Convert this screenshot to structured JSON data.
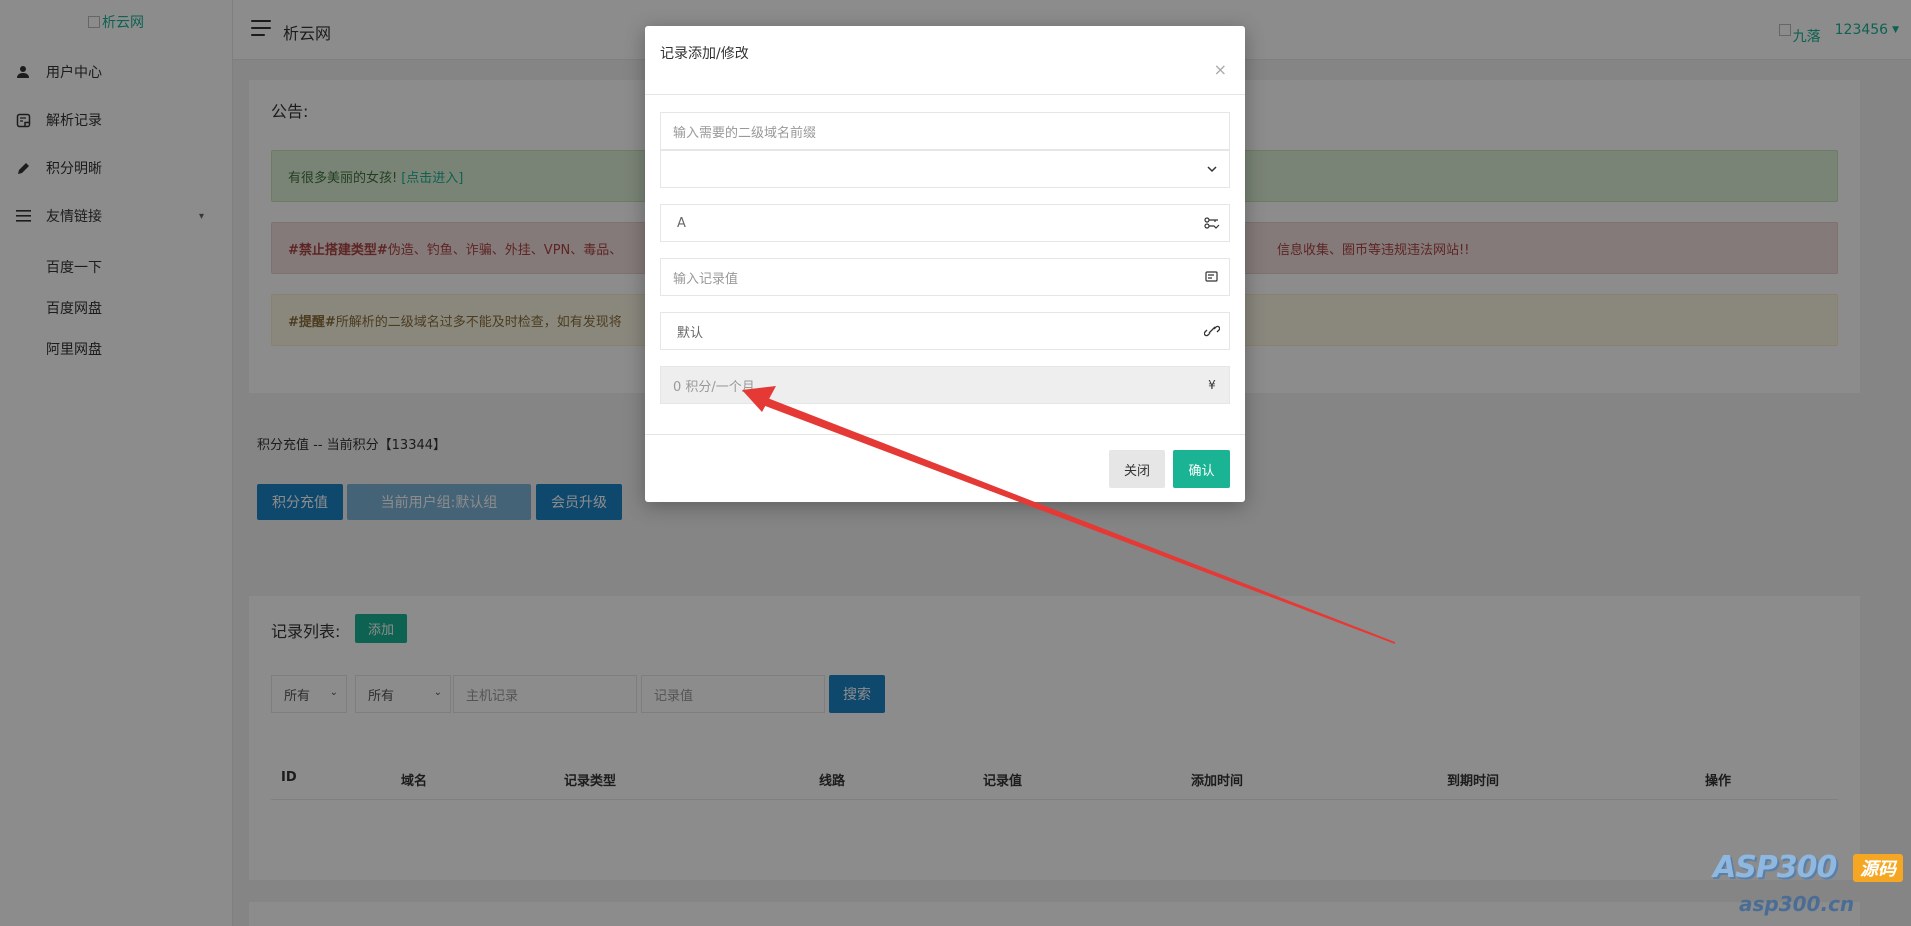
{
  "logo": {
    "alt": "析云网"
  },
  "sidebar": {
    "items": [
      {
        "label": "用户中心",
        "icon": "user-icon"
      },
      {
        "label": "解析记录",
        "icon": "note-icon"
      },
      {
        "label": "积分明晰",
        "icon": "pencil-icon"
      },
      {
        "label": "友情链接",
        "icon": "list-icon"
      }
    ],
    "sub_items": [
      {
        "label": "百度一下"
      },
      {
        "label": "百度网盘"
      },
      {
        "label": "阿里网盘"
      }
    ]
  },
  "header": {
    "brand": "析云网",
    "avatar_alt": "九落",
    "username": "123456"
  },
  "notice": {
    "title": "公告:",
    "success_text": "有很多美丽的女孩!",
    "success_link": "[点击进入]",
    "danger_bold": "#禁止搭建类型#",
    "danger_text": " 伪造、钓鱼、诈骗、外挂、VPN、毒品、",
    "danger_tail": "信息收集、圈币等违规违法网站!!",
    "warning_bold": "#提醒#",
    "warning_text": " 所解析的二级域名过多不能及时检查，如有发现将"
  },
  "recharge": {
    "title": "积分充值 -- 当前积分【13344】",
    "btn_recharge": "积分充值",
    "btn_group": "当前用户组:默认组",
    "btn_upgrade": "会员升级"
  },
  "records": {
    "title": "记录列表:",
    "btn_add": "添加",
    "filter1": "所有",
    "filter2": "所有",
    "host_placeholder": "主机记录",
    "value_placeholder": "记录值",
    "btn_search": "搜索",
    "columns": [
      "ID",
      "域名",
      "记录类型",
      "线路",
      "记录值",
      "添加时间",
      "到期时间",
      "操作"
    ]
  },
  "modal": {
    "title": "记录添加/修改",
    "close_glyph": "×",
    "prefix_placeholder": "输入需要的二级域名前缀",
    "domain_select": "",
    "type_value": "A",
    "value_placeholder": "输入记录值",
    "line_value": "默认",
    "cost_text": "0 积分/一个月",
    "cost_symbol": "¥",
    "btn_close": "关闭",
    "btn_confirm": "确认"
  },
  "watermark": {
    "brand": "ASP300",
    "badge": "源码",
    "url": "asp300.cn"
  },
  "colors": {
    "accent_green": "#1ab394",
    "accent_blue": "#1c84c6",
    "arrow_red": "#e53935"
  }
}
